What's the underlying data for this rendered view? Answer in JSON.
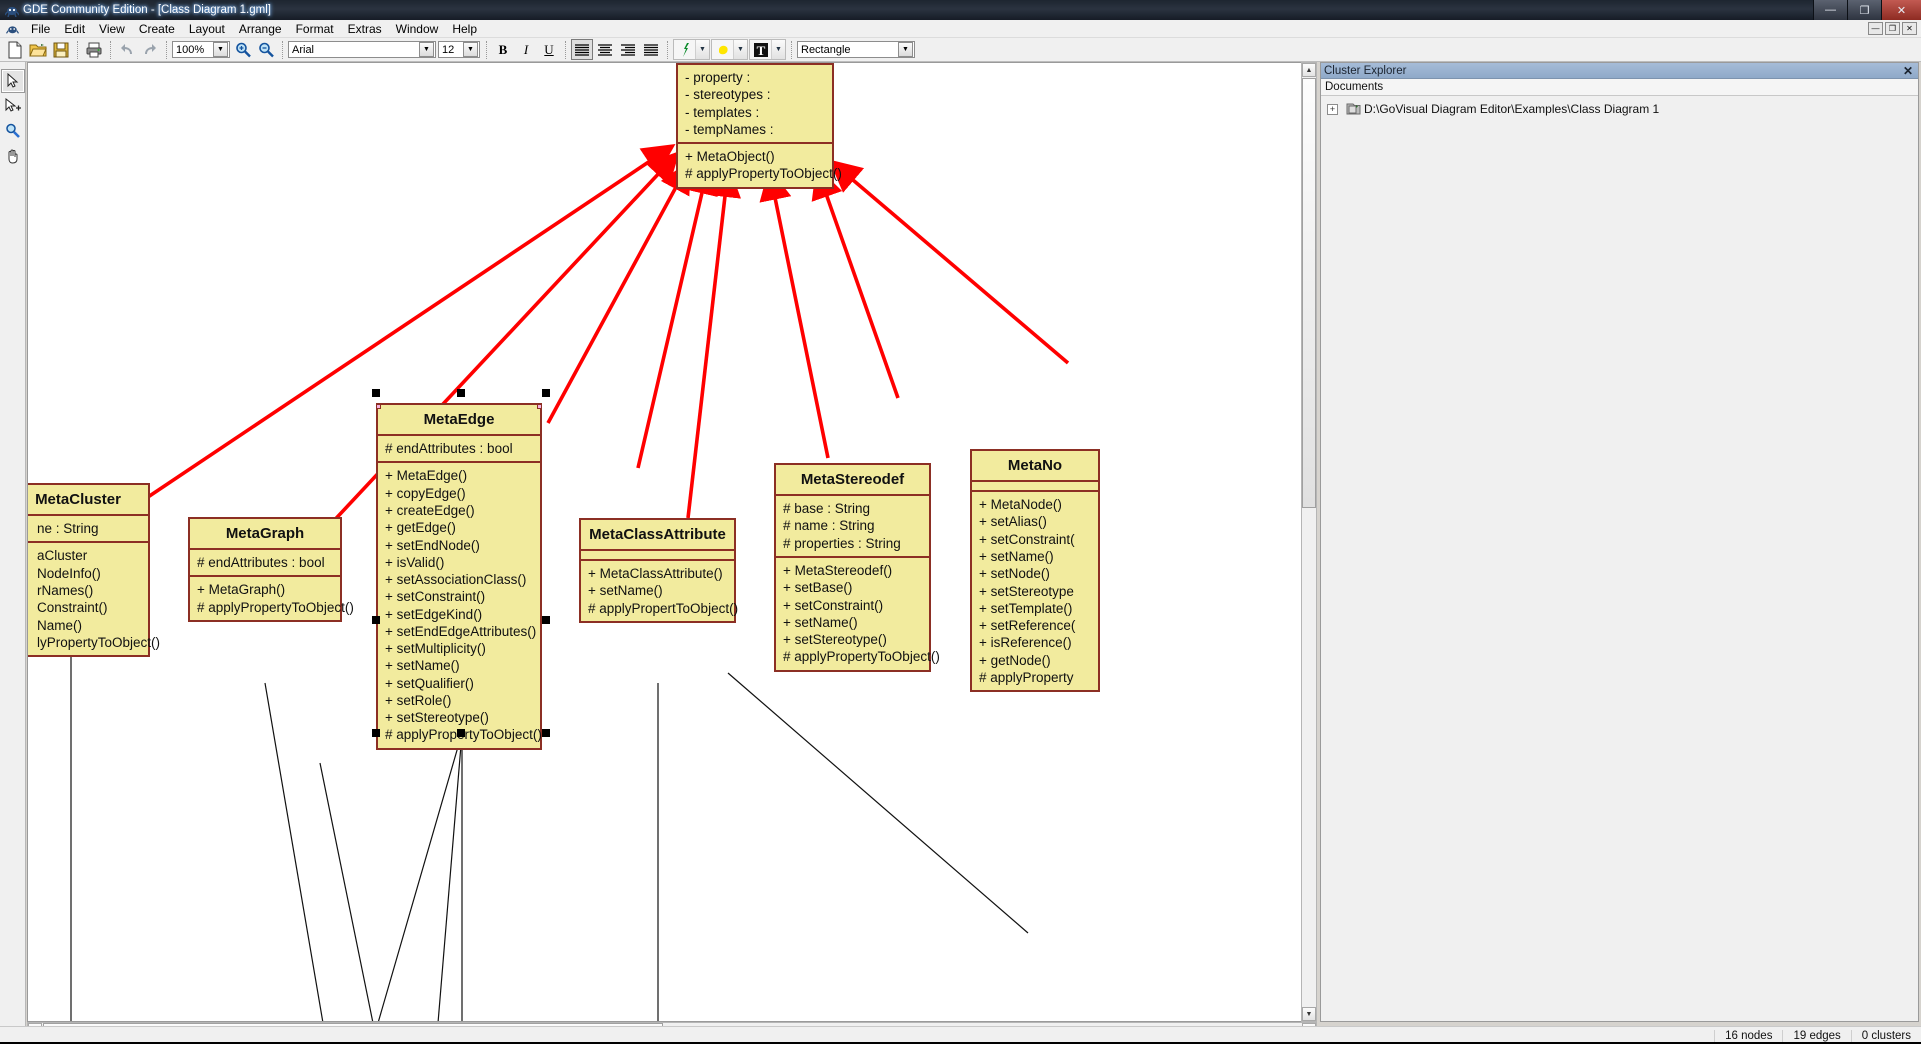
{
  "window": {
    "title": "GDE Community Edition - [Class Diagram 1.gml]",
    "app_icon": "app-icon",
    "buttons": {
      "minimize": "—",
      "restore": "❐",
      "close": "✕"
    },
    "mdi_buttons": {
      "minimize": "—",
      "restore": "❐",
      "close": "✕"
    }
  },
  "menu": {
    "items": [
      "File",
      "Edit",
      "View",
      "Create",
      "Layout",
      "Arrange",
      "Format",
      "Extras",
      "Window",
      "Help"
    ]
  },
  "toolbar": {
    "new_label": "new-document",
    "open_label": "open-folder",
    "save_label": "save-disk",
    "print_label": "printer",
    "undo_label": "undo-arrow",
    "redo_label": "redo-arrow",
    "zoom_value": "100%",
    "zoom_in_label": "zoom-in",
    "zoom_out_label": "zoom-out",
    "font_family_value": "Arial",
    "font_size_value": "12",
    "bold_label": "B",
    "italic_label": "I",
    "underline_label": "U",
    "align_left_label": "align-left",
    "align_center_label": "align-center",
    "align_right_label": "align-right",
    "align_justify_label": "align-justify",
    "line_color_label": "line-color",
    "fill_color_label": "fill-color",
    "text_color_label": "T",
    "shape_value": "Rectangle",
    "dropdown_arrow": "▼"
  },
  "palette": {
    "tools": [
      {
        "name": "select-tool",
        "active": true
      },
      {
        "name": "select-add-tool",
        "active": false
      },
      {
        "name": "zoom-tool",
        "active": false
      },
      {
        "name": "pan-tool",
        "active": false
      }
    ]
  },
  "explorer": {
    "title": "Cluster Explorer",
    "close_label": "✕",
    "column_header": "Documents",
    "tree": [
      {
        "expander": "+",
        "icon": "document-folder-icon",
        "label": "D:\\GoVisual Diagram Editor\\Examples\\Class Diagram 1"
      }
    ]
  },
  "status": {
    "nodes": "16 nodes",
    "edges": "19 edges",
    "clusters": "0 clusters"
  },
  "diagram": {
    "classes": [
      {
        "id": "metaobject",
        "name": "",
        "has_title": false,
        "attributes": [
          "- property :",
          "- stereotypes :",
          "- templates :",
          "- tempNames :"
        ],
        "operations": [
          "+ MetaObject()",
          "# applyPropertyToObject()"
        ]
      },
      {
        "id": "metaedge",
        "name": "MetaEdge",
        "has_title": true,
        "selected": true,
        "attributes": [
          "# endAttributes : bool"
        ],
        "operations": [
          "+ MetaEdge()",
          "+ copyEdge()",
          "+ createEdge()",
          "+ getEdge()",
          "+ setEndNode()",
          "+ isValid()",
          "+ setAssociationClass()",
          "+ setConstraint()",
          "+ setEdgeKind()",
          "+ setEndEdgeAttributes()",
          "+ setMultiplicity()",
          "+ setName()",
          "+ setQualifier()",
          "+ setRole()",
          "+ setStereotype()",
          "# applyPropertyToObject()"
        ]
      },
      {
        "id": "metacluster",
        "name": "MetaCluster",
        "has_title": true,
        "attributes": [
          "ne : String"
        ],
        "operations": [
          "aCluster",
          "NodeInfo()",
          "rNames()",
          "Constraint()",
          "Name()",
          "lyPropertyToObject()"
        ]
      },
      {
        "id": "metagraph",
        "name": "MetaGraph",
        "has_title": true,
        "attributes": [
          "# endAttributes : bool"
        ],
        "operations": [
          "+ MetaGraph()",
          "# applyPropertyToObject()"
        ]
      },
      {
        "id": "metaclassattribute",
        "name": "MetaClassAttribute",
        "has_title": true,
        "attributes": [],
        "operations": [
          "+ MetaClassAttribute()",
          "+ setName()",
          "# applyPropertToObject()"
        ]
      },
      {
        "id": "metastereodef",
        "name": "MetaStereodef",
        "has_title": true,
        "attributes": [
          "# base : String",
          "# name : String",
          "# properties : String"
        ],
        "operations": [
          "+ MetaStereodef()",
          "+ setBase()",
          "+ setConstraint()",
          "+ setName()",
          "+ setStereotype()",
          "# applyPropertyToObject()"
        ]
      },
      {
        "id": "metanode",
        "name": "MetaNo",
        "has_title": true,
        "attributes": [],
        "operations": [
          "+ MetaNode()",
          "+ setAlias()",
          "+ setConstraint(",
          "+ setName()",
          "+ setNode()",
          "+ setStereotype",
          "+ setTemplate()",
          "+ setReference(",
          "+ isReference()",
          "+ getNode()",
          "# applyProperty"
        ]
      }
    ],
    "colors": {
      "fill": "#f2eb9e",
      "border": "#8c2f24",
      "inheritance_edge": "#ff0000",
      "association_edge": "#000000"
    }
  }
}
